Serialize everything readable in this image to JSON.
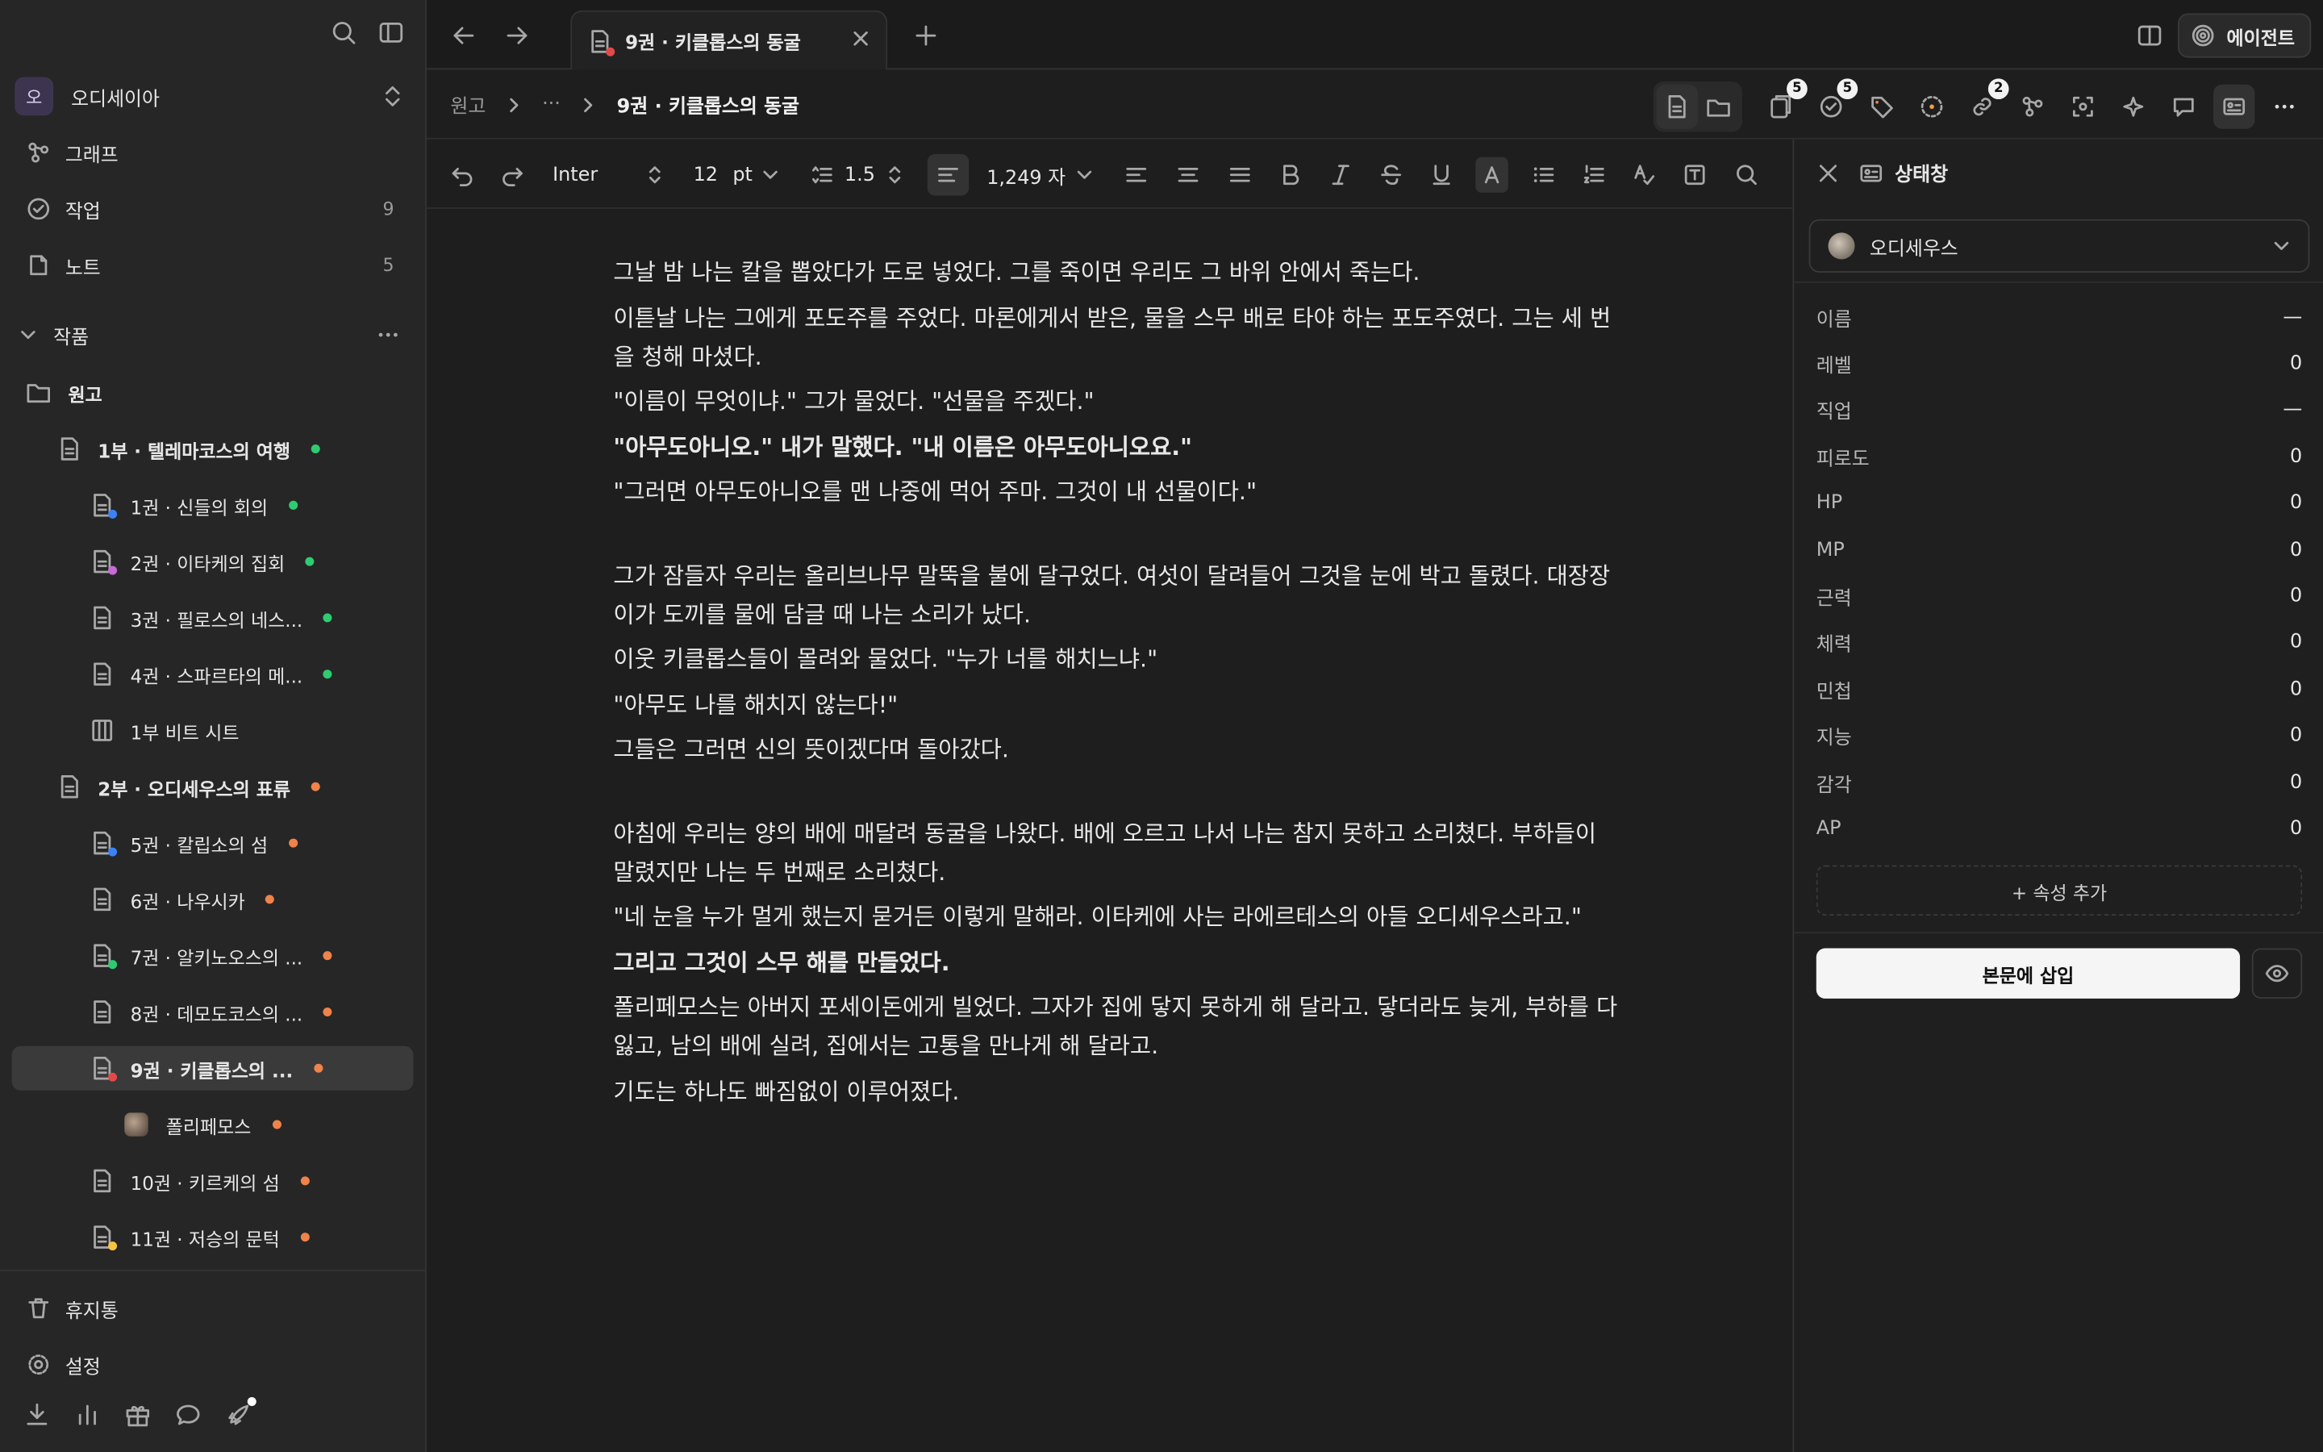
{
  "sidebar": {
    "workspace": {
      "initial": "오",
      "name": "오디세이아"
    },
    "nav": [
      {
        "label": "그래프",
        "count": ""
      },
      {
        "label": "작업",
        "count": "9"
      },
      {
        "label": "노트",
        "count": "5"
      }
    ],
    "section_title": "작품",
    "tree": [
      {
        "label": "원고"
      },
      {
        "label": "1부 · 텔레마코스의 여행",
        "dot": "#2ecc71"
      },
      {
        "label": "1권 · 신들의 회의",
        "dot": "#2ecc71",
        "mini": "#3b82f6"
      },
      {
        "label": "2권 · 이타케의 집회",
        "dot": "#2ecc71",
        "mini": "#c86bd6"
      },
      {
        "label": "3권 · 필로스의 네스...",
        "dot": "#2ecc71"
      },
      {
        "label": "4권 · 스파르타의 메...",
        "dot": "#2ecc71"
      },
      {
        "label": "1부 비트 시트"
      },
      {
        "label": "2부 · 오디세우스의 표류",
        "dot": "#f0834a"
      },
      {
        "label": "5권 · 칼립소의 섬",
        "dot": "#f0834a",
        "mini": "#3b82f6"
      },
      {
        "label": "6권 · 나우시카",
        "dot": "#f0834a"
      },
      {
        "label": "7권 · 알키노오스의 ...",
        "dot": "#f0834a",
        "mini": "#2ecc71"
      },
      {
        "label": "8권 · 데모도코스의 ...",
        "dot": "#f0834a"
      },
      {
        "label": "9권 · 키클롭스의 ...",
        "dot": "#f0834a",
        "mini": "#e24a4a"
      },
      {
        "label": "폴리페모스",
        "dot": "#f0834a"
      },
      {
        "label": "10권 · 키르케의 섬",
        "dot": "#f0834a"
      },
      {
        "label": "11권 · 저승의 문턱",
        "dot": "#f0834a",
        "mini": "#f5c542"
      }
    ],
    "trash": "휴지통",
    "settings": "설정"
  },
  "tabs": {
    "active_title": "9권 · 키클롭스의 동굴"
  },
  "agent_label": "에이전트",
  "breadcrumb": {
    "root": "원고",
    "ellipsis": "···",
    "current": "9권 · 키클롭스의 동굴"
  },
  "badges": {
    "pages": "5",
    "tasks": "5",
    "links": "2"
  },
  "toolbar": {
    "font": "Inter",
    "size": "12",
    "unit": "pt",
    "line_height": "1.5",
    "char_count": "1,249 자"
  },
  "document": {
    "blocks": [
      [
        {
          "text": "그날 밤 나는 칼을 뽑았다가 도로 넣었다. 그를 죽이면 우리도 그 바위 안에서 죽는다.",
          "bold": false
        },
        {
          "text": "이튿날 나는 그에게 포도주를 주었다. 마론에게서 받은, 물을 스무 배로 타야 하는 포도주였다. 그는 세 번을 청해 마셨다.",
          "bold": false
        },
        {
          "text": "\"이름이 무엇이냐.\" 그가 물었다. \"선물을 주겠다.\"",
          "bold": false
        },
        {
          "text": "\"아무도아니오.\" 내가 말했다. \"내 이름은 아무도아니오요.\"",
          "bold": true
        },
        {
          "text": "\"그러면 아무도아니오를 맨 나중에 먹어 주마. 그것이 내 선물이다.\"",
          "bold": false
        }
      ],
      [
        {
          "text": "그가 잠들자 우리는 올리브나무 말뚝을 불에 달구었다. 여섯이 달려들어 그것을 눈에 박고 돌렸다. 대장장이가 도끼를 물에 담글 때 나는 소리가 났다.",
          "bold": false
        },
        {
          "text": "이웃 키클롭스들이 몰려와 물었다. \"누가 너를 해치느냐.\"",
          "bold": false
        },
        {
          "text": "\"아무도 나를 해치지 않는다!\"",
          "bold": false
        },
        {
          "text": "그들은 그러면 신의 뜻이겠다며 돌아갔다.",
          "bold": false
        }
      ],
      [
        {
          "text": "아침에 우리는 양의 배에 매달려 동굴을 나왔다. 배에 오르고 나서 나는 참지 못하고 소리쳤다. 부하들이 말렸지만 나는 두 번째로 소리쳤다.",
          "bold": false
        },
        {
          "text": "\"네 눈을 누가 멀게 했는지 묻거든 이렇게 말해라. 이타케에 사는 라에르테스의 아들 오디세우스라고.\"",
          "bold": false
        },
        {
          "text": "그리고 그것이 스무 해를 만들었다.",
          "bold": true
        },
        {
          "text": "폴리페모스는 아버지 포세이돈에게 빌었다. 그자가 집에 닿지 못하게 해 달라고. 닿더라도 늦게, 부하를 다 잃고, 남의 배에 실려, 집에서는 고통을 만나게 해 달라고.",
          "bold": false
        },
        {
          "text": "기도는 하나도 빠짐없이 이루어졌다.",
          "bold": false
        }
      ]
    ]
  },
  "panel": {
    "title": "상태창",
    "character": "오디세우스",
    "stats": [
      {
        "label": "이름",
        "value": "—"
      },
      {
        "label": "레벨",
        "value": "0"
      },
      {
        "label": "직업",
        "value": "—"
      },
      {
        "label": "피로도",
        "value": "0"
      },
      {
        "label": "HP",
        "value": "0"
      },
      {
        "label": "MP",
        "value": "0"
      },
      {
        "label": "근력",
        "value": "0"
      },
      {
        "label": "체력",
        "value": "0"
      },
      {
        "label": "민첩",
        "value": "0"
      },
      {
        "label": "지능",
        "value": "0"
      },
      {
        "label": "감각",
        "value": "0"
      },
      {
        "label": "AP",
        "value": "0"
      }
    ],
    "add_property": "+ 속성 추가",
    "insert_label": "본문에 삽입"
  }
}
